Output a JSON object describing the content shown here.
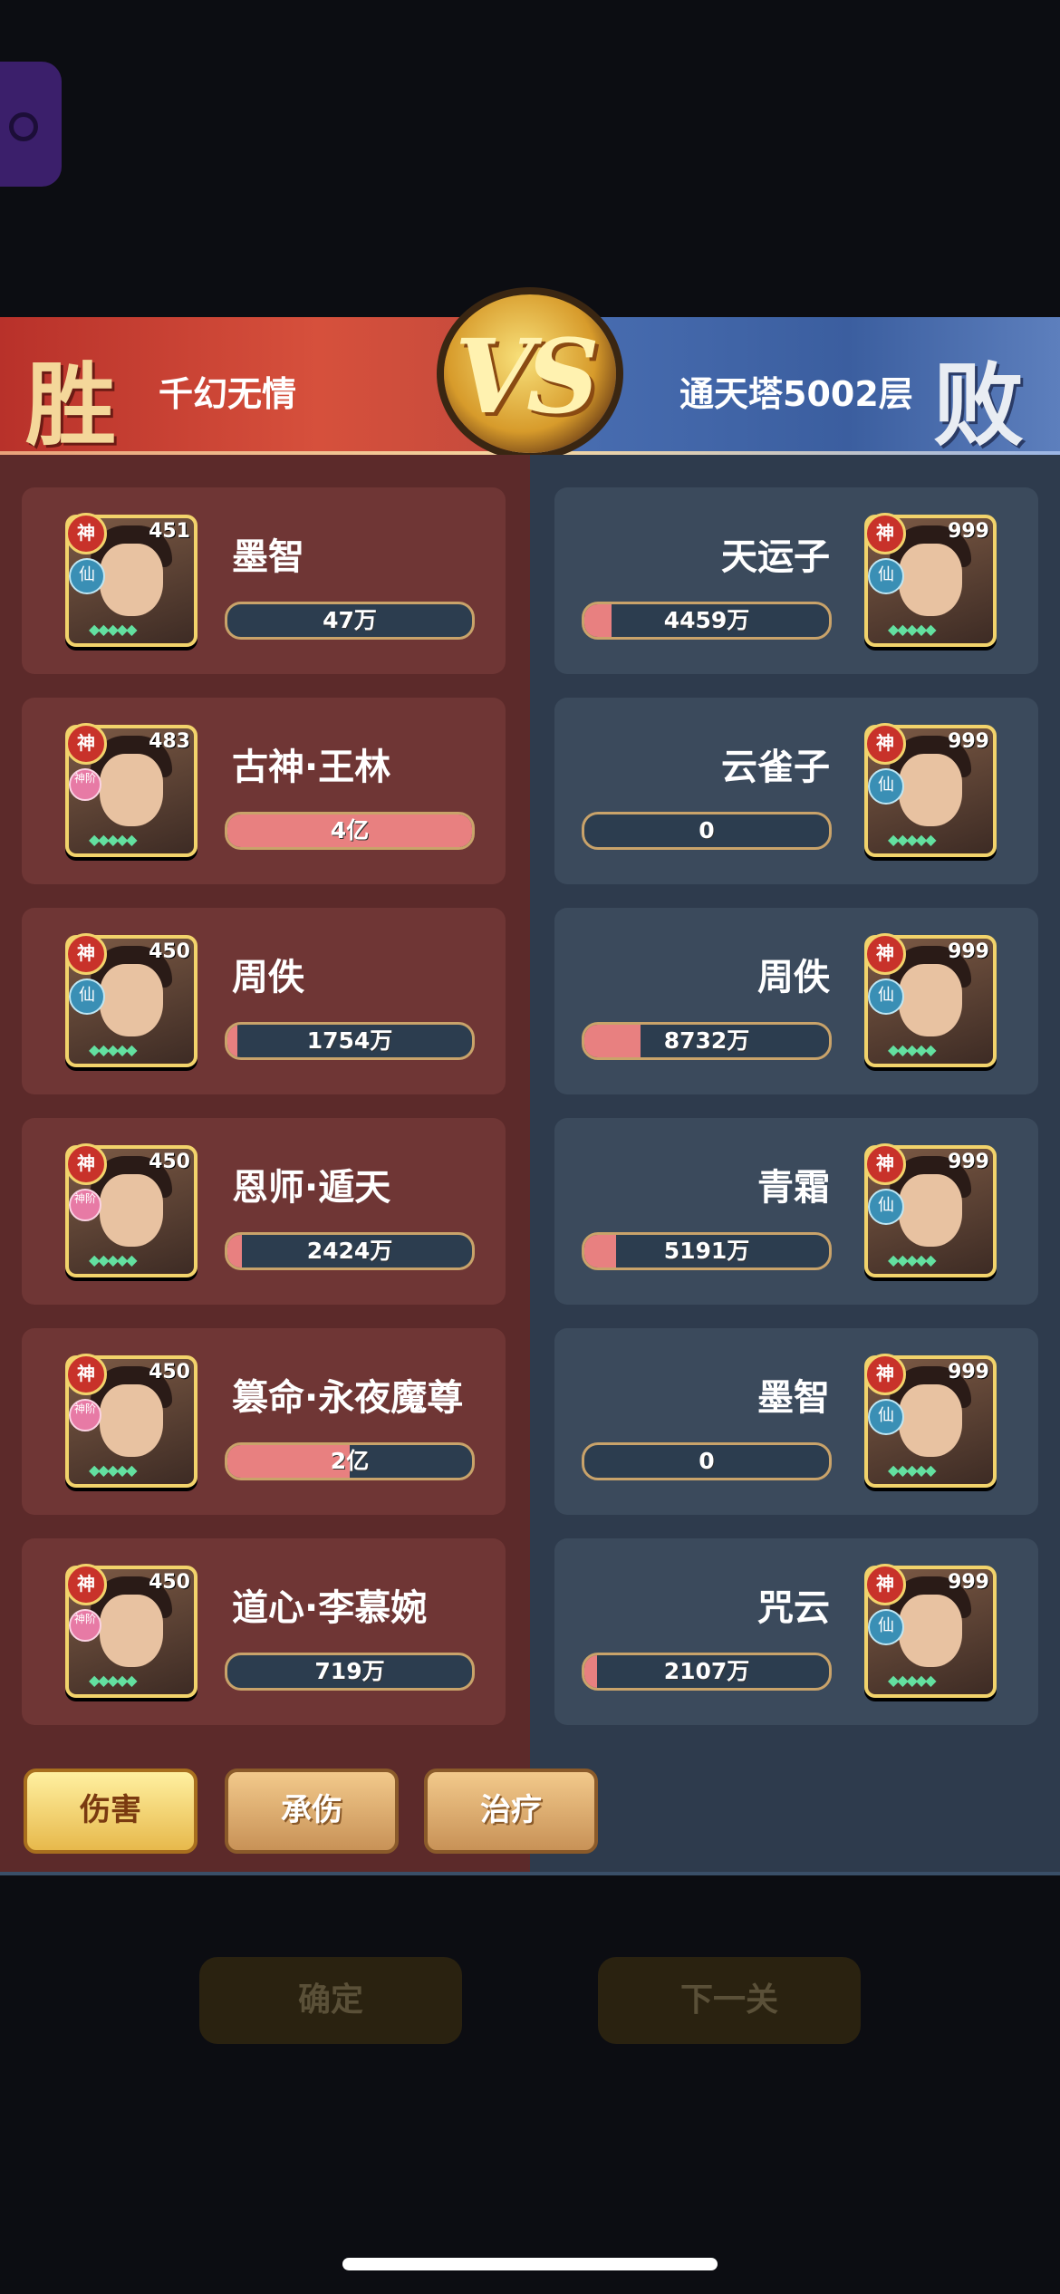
{
  "battle": {
    "left": {
      "result": "胜",
      "name": "千幻无情"
    },
    "right": {
      "result": "败",
      "name": "通天塔5002层"
    },
    "vs_label": "VS"
  },
  "left_heroes": [
    {
      "name": "墨智",
      "level": "451",
      "badge": "神",
      "class_badge": "仙",
      "value": "47万",
      "bar_fraction": 0.0
    },
    {
      "name": "古神·王林",
      "level": "483",
      "badge": "神",
      "class_badge": "神阶",
      "value": "4亿",
      "bar_fraction": 1.0
    },
    {
      "name": "周佚",
      "level": "450",
      "badge": "神",
      "class_badge": "仙",
      "value": "1754万",
      "bar_fraction": 0.04
    },
    {
      "name": "恩师·遁天",
      "level": "450",
      "badge": "神",
      "class_badge": "神阶",
      "value": "2424万",
      "bar_fraction": 0.06
    },
    {
      "name": "篡命·永夜魔尊",
      "level": "450",
      "badge": "神",
      "class_badge": "神阶",
      "value": "2亿",
      "bar_fraction": 0.5
    },
    {
      "name": "道心·李慕婉",
      "level": "450",
      "badge": "神",
      "class_badge": "神阶",
      "value": "719万",
      "bar_fraction": 0.0
    }
  ],
  "right_heroes": [
    {
      "name": "天运子",
      "level": "999",
      "badge": "神",
      "class_badge": "仙",
      "value": "4459万",
      "bar_fraction": 0.11
    },
    {
      "name": "云雀子",
      "level": "999",
      "badge": "神",
      "class_badge": "仙",
      "value": "0",
      "bar_fraction": 0.0
    },
    {
      "name": "周佚",
      "level": "999",
      "badge": "神",
      "class_badge": "仙",
      "value": "8732万",
      "bar_fraction": 0.23
    },
    {
      "name": "青霜",
      "level": "999",
      "badge": "神",
      "class_badge": "仙",
      "value": "5191万",
      "bar_fraction": 0.13
    },
    {
      "name": "墨智",
      "level": "999",
      "badge": "神",
      "class_badge": "仙",
      "value": "0",
      "bar_fraction": 0.0
    },
    {
      "name": "咒云",
      "level": "999",
      "badge": "神",
      "class_badge": "仙",
      "value": "2107万",
      "bar_fraction": 0.05
    }
  ],
  "tabs": [
    "伤害",
    "承伤",
    "治疗"
  ],
  "actions": {
    "confirm": "确定",
    "next": "下一关"
  },
  "colors": {
    "win_red": "#c8322a",
    "lose_blue": "#3b5e9f",
    "bar_fill": "#e88080",
    "gold": "#f2d36b"
  }
}
